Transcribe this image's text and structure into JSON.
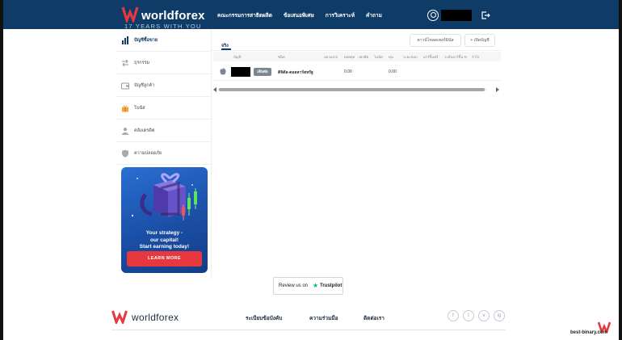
{
  "brand": {
    "name": "worldforex",
    "tagline": "17 YEARS WITH YOU",
    "accent": "#e8383f",
    "header_bg": "#0f3b67"
  },
  "topnav": {
    "items": [
      "คณะกรรมการสาธิตผลิต",
      "ข้อเสนอพิเศษ",
      "การวิเคราะห์",
      "คำถาม"
    ]
  },
  "sidebar": {
    "items": [
      {
        "label": "บัญชีซื้อขาย",
        "icon": "bar-chart-icon",
        "active": true
      },
      {
        "label": "ธุรกรรม",
        "icon": "transfer-icon",
        "active": false
      },
      {
        "label": "บัญชีลูกค้า",
        "icon": "wallet-icon",
        "active": false
      },
      {
        "label": "โบนัส",
        "icon": "gift-icon",
        "active": false
      },
      {
        "label": "คลังเครดิต",
        "icon": "user-icon",
        "active": false
      },
      {
        "label": "ความปลอดภัย",
        "icon": "shield-icon",
        "active": false
      }
    ]
  },
  "promo": {
    "line1": "Your strategy -",
    "line2": "our capital!",
    "line3": "Start earning today!",
    "button": "LEARN MORE"
  },
  "main": {
    "tab_real": "จริง",
    "download_button": "ดาวน์โหลดเทอร์มินัล",
    "open_account_button": "+ เปิดบัญชี",
    "columns": [
      "บัญชี",
      "ชนิด",
      "เลเวอเรจ",
      "ยอดดุล",
      "เครดิต",
      "โบนัส",
      "ทุน",
      "ระยะขอบ",
      "มาร์จิ้นฟรี",
      "ระดับมาร์จิ้น %",
      "กำไร"
    ],
    "rows": [
      {
        "badge": "เดินต่อ",
        "type": "ดิจิตัล-ดอลลาร์สหรัฐ",
        "balance": "0.00",
        "equity": "0.00"
      }
    ]
  },
  "trustpilot": {
    "label": "Review us on",
    "brand": "Trustpilot"
  },
  "footer": {
    "brand": "worldforex",
    "links": [
      "ระเบียบข้อบังคับ",
      "ความร่วมมือ",
      "ติดต่อเรา"
    ],
    "social": [
      "f",
      "t",
      "v",
      "ig"
    ]
  },
  "watermark": {
    "text": "best-binary.com"
  }
}
